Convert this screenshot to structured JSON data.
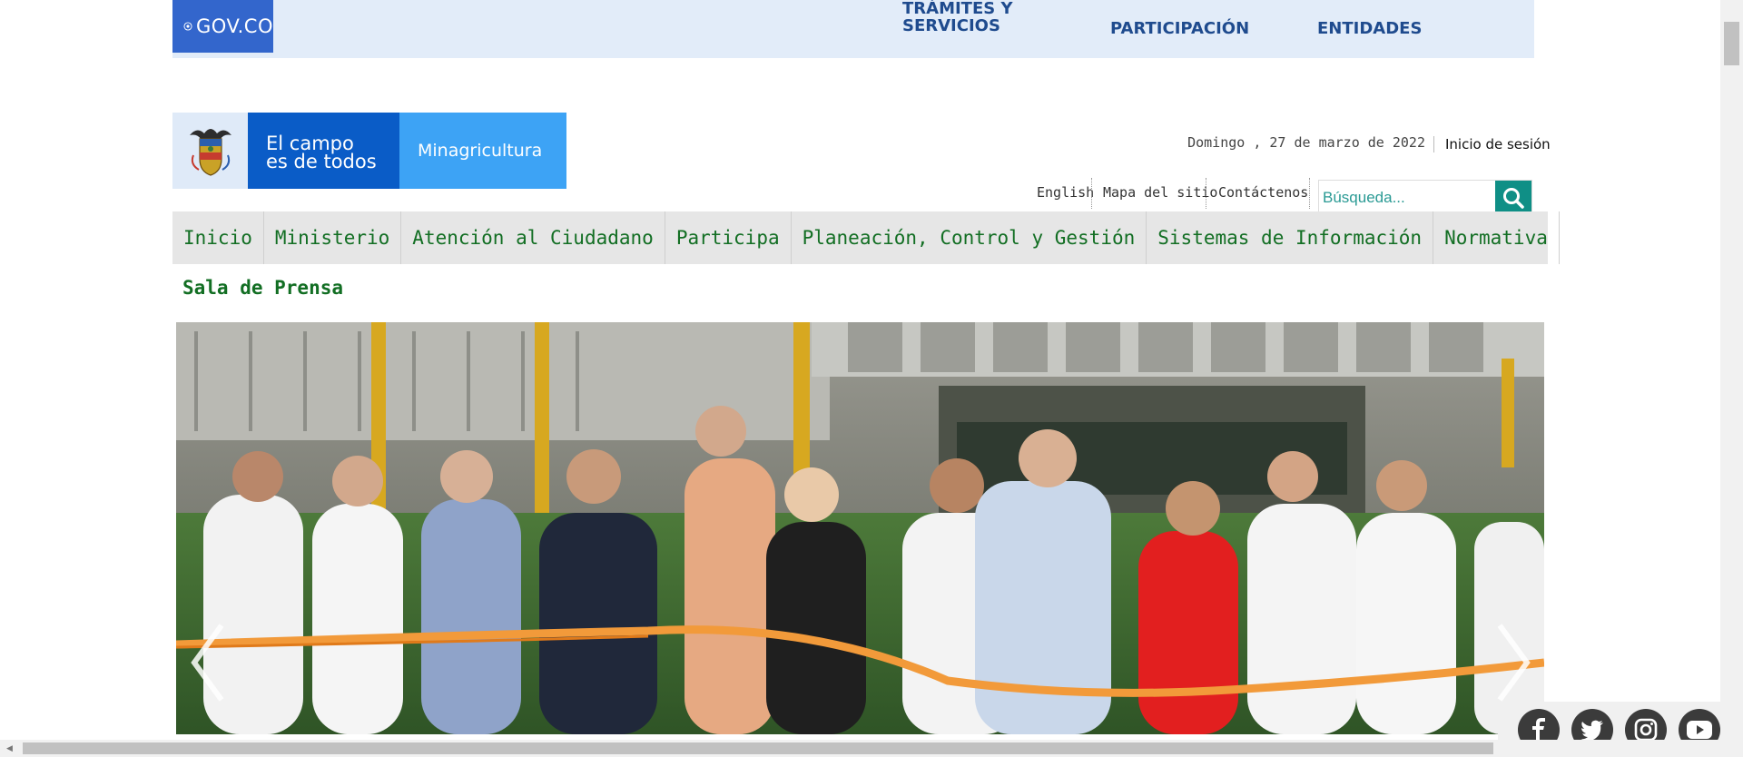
{
  "govbar": {
    "logo_text": "GOV.CO",
    "links": [
      {
        "label_line1": "TRÁMITES Y",
        "label_line2": "SERVICIOS"
      },
      {
        "label_line1": "PARTICIPACIÓN",
        "label_line2": ""
      },
      {
        "label_line1": "ENTIDADES",
        "label_line2": ""
      }
    ]
  },
  "brand": {
    "slogan_line1": "El campo",
    "slogan_line2": "es de todos",
    "name": "Minagricultura"
  },
  "header": {
    "date": "Domingo , 27 de marzo de 2022",
    "login": "Inicio de sesión",
    "utility_links": [
      "English",
      "Mapa del sitio",
      "Contáctenos"
    ],
    "search_placeholder": "Búsqueda..."
  },
  "mainnav": {
    "items": [
      "Inicio",
      "Ministerio",
      "Atención al Ciudadano",
      "Participa",
      "Planeación, Control y Gestión",
      "Sistemas de Información",
      "Normativa"
    ]
  },
  "section": {
    "title": "Sala de Prensa"
  },
  "hero": {
    "image": "ribbon-cutting-photo",
    "prev_icon": "chevron-left-icon",
    "next_icon": "chevron-right-icon"
  },
  "social": {
    "icons": [
      "facebook-icon",
      "twitter-icon",
      "instagram-icon",
      "youtube-icon"
    ]
  },
  "colors": {
    "gov_blue": "#3366cc",
    "gov_bar": "#e2ecf9",
    "nav_green": "#126e23",
    "search_teal": "#0f8f86",
    "brand_blue": "#0a5cc7",
    "brand_light": "#3da3f5"
  }
}
